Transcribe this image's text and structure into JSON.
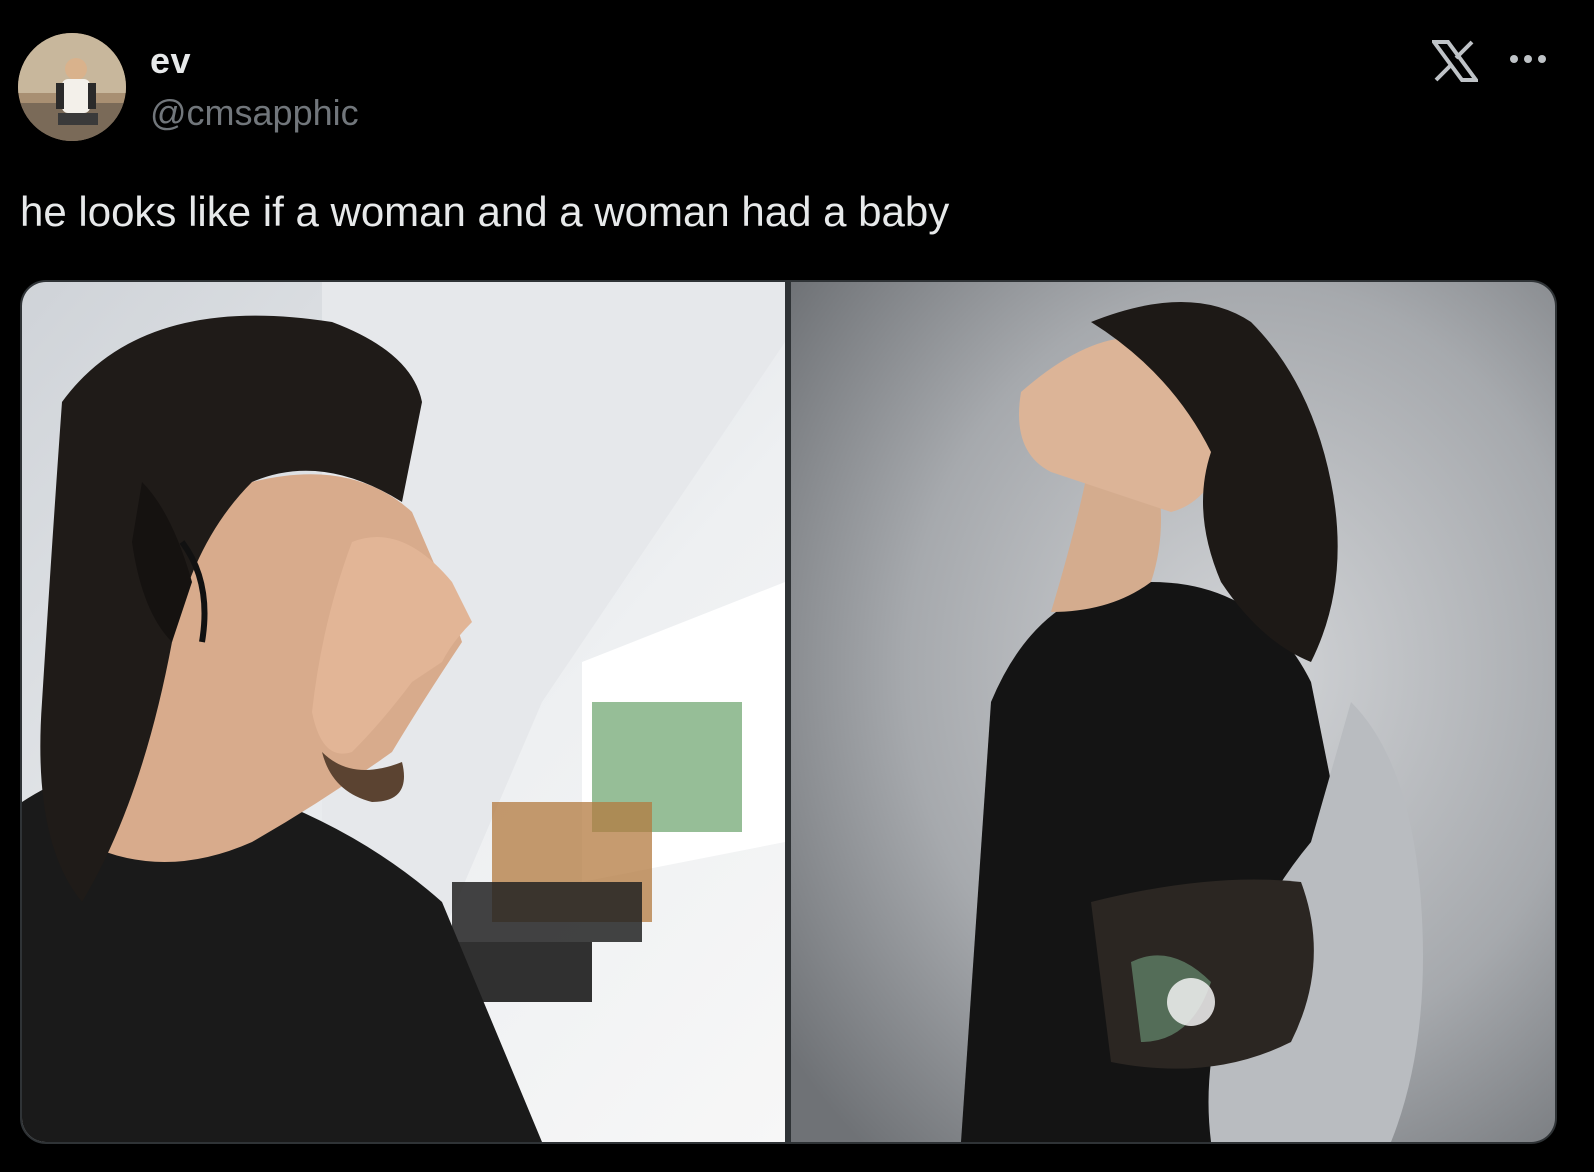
{
  "author": {
    "display_name": "ev",
    "handle": "@cmsapphic",
    "avatar_icon": "profile-photo"
  },
  "header": {
    "logo_icon": "x-logo-icon",
    "more_icon": "more-options-icon"
  },
  "tweet": {
    "text": "he looks like if a woman and a woman had a baby"
  },
  "media": {
    "photos": [
      {
        "icon": "photo-left"
      },
      {
        "icon": "photo-right"
      }
    ]
  },
  "colors": {
    "background": "#000000",
    "text_primary": "#e7e9ea",
    "text_secondary": "#71767b",
    "border": "#2f3336"
  }
}
